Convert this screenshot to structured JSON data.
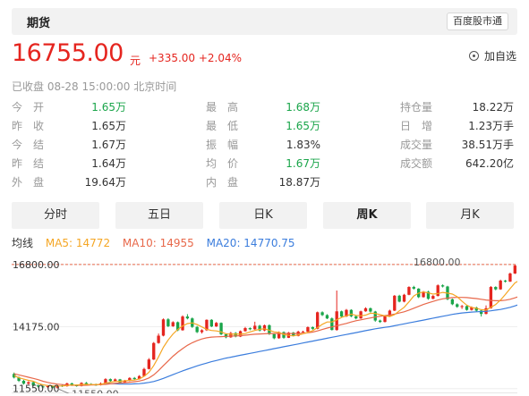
{
  "header": {
    "title": "期货",
    "source_label": "百度股市通"
  },
  "quote": {
    "price": "16755.00",
    "unit": "元",
    "change": "+335.00 +2.04%",
    "watch_label": "加自选",
    "status": "已收盘  08-28 15:00:00  北京时间"
  },
  "stats": [
    {
      "label": "今　开",
      "value": "1.65万",
      "color": "green"
    },
    {
      "label": "最　高",
      "value": "1.68万",
      "color": "green"
    },
    {
      "label": "持仓量",
      "value": "18.22万",
      "color": "black"
    },
    {
      "label": "昨　收",
      "value": "1.65万",
      "color": "black"
    },
    {
      "label": "最　低",
      "value": "1.65万",
      "color": "green"
    },
    {
      "label": "日　增",
      "value": "1.23万手",
      "color": "black"
    },
    {
      "label": "今　结",
      "value": "1.67万",
      "color": "black"
    },
    {
      "label": "振　幅",
      "value": "1.83%",
      "color": "black"
    },
    {
      "label": "成交量",
      "value": "38.51万手",
      "color": "black"
    },
    {
      "label": "昨　结",
      "value": "1.64万",
      "color": "black"
    },
    {
      "label": "均　价",
      "value": "1.67万",
      "color": "green"
    },
    {
      "label": "成交额",
      "value": "642.20亿",
      "color": "black"
    },
    {
      "label": "外　盘",
      "value": "19.64万",
      "color": "black"
    },
    {
      "label": "内　盘",
      "value": "18.87万",
      "color": "black"
    }
  ],
  "tabs": [
    "分时",
    "五日",
    "日K",
    "周K",
    "月K"
  ],
  "active_tab": "周K",
  "legend": {
    "title": "均线",
    "ma5": "MA5: 14772",
    "ma10": "MA10: 14955",
    "ma20": "MA20: 14770.75"
  },
  "colors": {
    "up": "#e5251f",
    "down": "#1aa54a",
    "ma5": "#f5a623",
    "ma10": "#e8684a",
    "ma20": "#3b7ddd"
  },
  "chart_data": {
    "type": "candlestick",
    "y_tick_labels": [
      "16800.00",
      "14175.00",
      "11550.00"
    ],
    "y_ticks": [
      16800,
      14175,
      11550
    ],
    "ylim": [
      11350,
      17100
    ],
    "annotations": {
      "high_label": "16800.00",
      "low_label": "11550.00",
      "high_value": 16800,
      "low_value": 11550
    },
    "candles": [
      [
        12170,
        12020,
        12230,
        11980
      ],
      [
        12020,
        11880,
        12060,
        11830
      ],
      [
        11880,
        11760,
        11920,
        11720
      ],
      [
        11760,
        11820,
        11860,
        11720
      ],
      [
        11820,
        11680,
        11840,
        11640
      ],
      [
        11680,
        11640,
        11720,
        11600
      ],
      [
        11640,
        11610,
        11680,
        11580
      ],
      [
        11610,
        11660,
        11700,
        11580
      ],
      [
        11660,
        11590,
        11690,
        11560
      ],
      [
        11590,
        11680,
        11710,
        11550
      ],
      [
        11680,
        11650,
        11720,
        11620
      ],
      [
        11650,
        11770,
        11800,
        11630
      ],
      [
        11770,
        11690,
        11800,
        11660
      ],
      [
        11690,
        11660,
        11720,
        11630
      ],
      [
        11660,
        11790,
        11820,
        11640
      ],
      [
        11790,
        11740,
        11830,
        11710
      ],
      [
        11740,
        11720,
        11780,
        11690
      ],
      [
        11720,
        11700,
        11760,
        11670
      ],
      [
        11700,
        11770,
        11810,
        11680
      ],
      [
        11770,
        11950,
        11990,
        11750
      ],
      [
        11950,
        11870,
        11980,
        11840
      ],
      [
        11870,
        11940,
        11980,
        11840
      ],
      [
        11940,
        11810,
        11960,
        11790
      ],
      [
        11810,
        11880,
        11920,
        11790
      ],
      [
        11880,
        12000,
        12030,
        11860
      ],
      [
        12000,
        11950,
        12040,
        11920
      ],
      [
        11950,
        12080,
        12120,
        11930
      ],
      [
        12080,
        12380,
        12430,
        12060
      ],
      [
        12380,
        12780,
        12840,
        12360
      ],
      [
        12780,
        13480,
        13520,
        12760
      ],
      [
        13480,
        13790,
        13880,
        13450
      ],
      [
        13790,
        14480,
        14520,
        13760
      ],
      [
        14480,
        14190,
        14530,
        14150
      ],
      [
        14190,
        14360,
        14400,
        14160
      ],
      [
        14360,
        14020,
        14390,
        13980
      ],
      [
        14020,
        14600,
        14650,
        14000
      ],
      [
        14600,
        14520,
        14700,
        14480
      ],
      [
        14520,
        14160,
        14560,
        14120
      ],
      [
        14160,
        13940,
        14200,
        13900
      ],
      [
        13940,
        14020,
        14060,
        13880
      ],
      [
        14020,
        14460,
        14480,
        13990
      ],
      [
        14460,
        14180,
        14490,
        14150
      ],
      [
        14180,
        14330,
        14370,
        14160
      ],
      [
        14330,
        13850,
        14350,
        13810
      ],
      [
        13850,
        13720,
        13880,
        13680
      ],
      [
        13720,
        13900,
        13950,
        13700
      ],
      [
        13900,
        13750,
        13940,
        13720
      ],
      [
        13750,
        13980,
        14010,
        13730
      ],
      [
        13980,
        14110,
        14160,
        13960
      ],
      [
        14110,
        14060,
        14140,
        14020
      ],
      [
        14060,
        14210,
        14380,
        14040
      ],
      [
        14210,
        14010,
        14250,
        13970
      ],
      [
        14010,
        14230,
        14260,
        13980
      ],
      [
        14230,
        13860,
        14270,
        13820
      ],
      [
        13860,
        13680,
        13890,
        13640
      ],
      [
        13680,
        13940,
        13970,
        13660
      ],
      [
        13940,
        13700,
        13970,
        13660
      ],
      [
        13700,
        13920,
        13950,
        13690
      ],
      [
        13920,
        13780,
        13950,
        13760
      ],
      [
        13780,
        13960,
        14000,
        13760
      ],
      [
        13960,
        13960,
        14000,
        13930
      ],
      [
        13960,
        14150,
        14180,
        13940
      ],
      [
        14150,
        14080,
        14180,
        14040
      ],
      [
        14080,
        14780,
        14810,
        14060
      ],
      [
        14780,
        14660,
        14820,
        14620
      ],
      [
        14660,
        14520,
        14700,
        14490
      ],
      [
        14520,
        14030,
        14560,
        14010
      ],
      [
        14030,
        14820,
        15700,
        14000
      ],
      [
        14820,
        14600,
        14850,
        14560
      ],
      [
        14600,
        14880,
        14920,
        14580
      ],
      [
        14880,
        14610,
        14910,
        14570
      ],
      [
        14610,
        14520,
        14640,
        14480
      ],
      [
        14520,
        14820,
        14850,
        14500
      ],
      [
        14820,
        14950,
        14990,
        14800
      ],
      [
        14950,
        14810,
        14980,
        14770
      ],
      [
        14810,
        14430,
        14840,
        14380
      ],
      [
        14430,
        14370,
        14470,
        14330
      ],
      [
        14370,
        14620,
        14660,
        14350
      ],
      [
        14620,
        14850,
        14890,
        14600
      ],
      [
        14850,
        15480,
        15510,
        14830
      ],
      [
        15480,
        15230,
        15520,
        15200
      ],
      [
        15230,
        15520,
        15560,
        15200
      ],
      [
        15520,
        15850,
        15880,
        15500
      ],
      [
        15850,
        15780,
        15900,
        15740
      ],
      [
        15780,
        15420,
        15800,
        15380
      ],
      [
        15420,
        15650,
        15680,
        15400
      ],
      [
        15650,
        15350,
        15690,
        15310
      ],
      [
        15350,
        15470,
        15510,
        15330
      ],
      [
        15470,
        15920,
        15960,
        15450
      ],
      [
        15920,
        15870,
        15960,
        15830
      ],
      [
        15870,
        15330,
        15900,
        15290
      ],
      [
        15330,
        15120,
        15360,
        15080
      ],
      [
        15120,
        15010,
        15160,
        14970
      ],
      [
        15010,
        15040,
        15090,
        14920
      ],
      [
        15040,
        14880,
        15080,
        14850
      ],
      [
        14880,
        14980,
        15030,
        14850
      ],
      [
        14980,
        14850,
        15020,
        14810
      ],
      [
        14850,
        14710,
        14880,
        14600
      ],
      [
        14710,
        14950,
        15070,
        14690
      ],
      [
        14950,
        15850,
        15890,
        14930
      ],
      [
        15850,
        15750,
        15880,
        15710
      ],
      [
        15750,
        16120,
        16160,
        15730
      ],
      [
        16120,
        16080,
        16150,
        16040
      ],
      [
        16080,
        16420,
        16460,
        16060
      ],
      [
        16420,
        16755,
        16800,
        16400
      ]
    ],
    "ma5": [
      12100,
      12010,
      11950,
      11900,
      11860,
      11770,
      11710,
      11680,
      11660,
      11660,
      11660,
      11680,
      11700,
      11700,
      11720,
      11730,
      11720,
      11720,
      11730,
      11780,
      11820,
      11850,
      11860,
      11880,
      11900,
      11910,
      11960,
      12070,
      12240,
      12520,
      12890,
      13300,
      13610,
      13860,
      14050,
      14200,
      14300,
      14330,
      14260,
      14160,
      14060,
      14010,
      13990,
      13950,
      13870,
      13850,
      13860,
      13850,
      13880,
      13950,
      14010,
      14060,
      14080,
      14020,
      13950,
      13930,
      13840,
      13800,
      13780,
      13820,
      13870,
      13930,
      14000,
      14130,
      14270,
      14370,
      14370,
      14460,
      14560,
      14630,
      14700,
      14650,
      14630,
      14660,
      14740,
      14730,
      14680,
      14630,
      14600,
      14680,
      14840,
      14990,
      15220,
      15470,
      15590,
      15640,
      15600,
      15550,
      15570,
      15620,
      15590,
      15550,
      15440,
      15250,
      15080,
      14980,
      14950,
      14890,
      14870,
      14990,
      15110,
      15300,
      15530,
      15780,
      16020,
      16140
    ],
    "ma10": [
      12180,
      12130,
      12080,
      12030,
      11980,
      11930,
      11860,
      11810,
      11770,
      11740,
      11720,
      11700,
      11690,
      11690,
      11690,
      11690,
      11700,
      11710,
      11720,
      11730,
      11750,
      11770,
      11790,
      11800,
      11820,
      11840,
      11870,
      11920,
      12000,
      12130,
      12310,
      12520,
      12720,
      12920,
      13090,
      13240,
      13380,
      13490,
      13580,
      13650,
      13700,
      13730,
      13740,
      13750,
      13760,
      13770,
      13780,
      13790,
      13810,
      13830,
      13850,
      13860,
      13870,
      13880,
      13880,
      13880,
      13880,
      13880,
      13880,
      13880,
      13890,
      13910,
      13940,
      13990,
      14050,
      14110,
      14160,
      14210,
      14260,
      14310,
      14370,
      14420,
      14460,
      14500,
      14540,
      14580,
      14610,
      14640,
      14660,
      14700,
      14750,
      14800,
      14870,
      14950,
      15030,
      15110,
      15180,
      15240,
      15300,
      15350,
      15380,
      15400,
      15410,
      15410,
      15400,
      15380,
      15360,
      15330,
      15300,
      15280,
      15270,
      15270,
      15290,
      15330,
      15390,
      15460
    ],
    "ma20": [
      null,
      null,
      null,
      null,
      null,
      null,
      null,
      null,
      null,
      null,
      null,
      null,
      null,
      null,
      null,
      null,
      null,
      null,
      null,
      11780,
      11760,
      11750,
      11740,
      11740,
      11740,
      11750,
      11760,
      11780,
      11810,
      11850,
      11910,
      11980,
      12060,
      12140,
      12220,
      12300,
      12370,
      12440,
      12510,
      12570,
      12630,
      12690,
      12740,
      12790,
      12840,
      12880,
      12920,
      12960,
      13000,
      13040,
      13080,
      13120,
      13160,
      13200,
      13240,
      13280,
      13320,
      13360,
      13400,
      13440,
      13480,
      13520,
      13560,
      13600,
      13640,
      13680,
      13720,
      13760,
      13800,
      13840,
      13880,
      13920,
      13960,
      14000,
      14040,
      14080,
      14110,
      14140,
      14170,
      14210,
      14250,
      14290,
      14330,
      14370,
      14410,
      14450,
      14490,
      14530,
      14570,
      14610,
      14650,
      14690,
      14720,
      14750,
      14770,
      14790,
      14800,
      14810,
      14820,
      14840,
      14870,
      14900,
      14940,
      14990,
      15050,
      15120
    ]
  }
}
